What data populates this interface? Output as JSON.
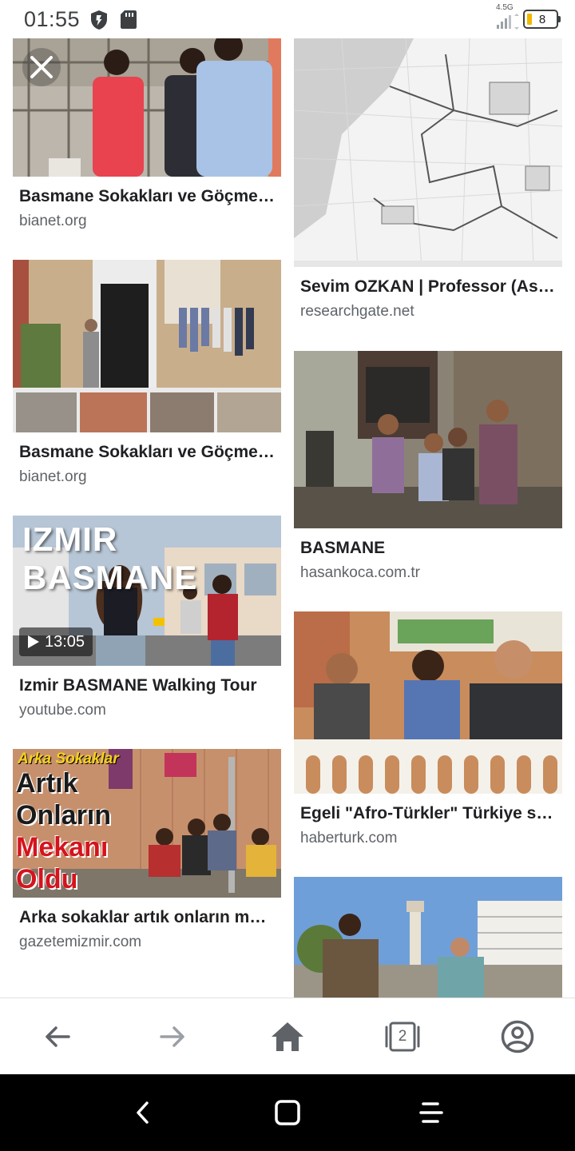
{
  "status_bar": {
    "time": "01:55",
    "network": "4.5G",
    "battery_level": "8",
    "battery_color": "#f2b800"
  },
  "results": [
    {
      "title": "Basmane Sokakları ve Göçmenler",
      "source": "bianet.org"
    },
    {
      "title": "Sevim OZKAN | Professor (Associate)",
      "source": "researchgate.net"
    },
    {
      "title": "Basmane Sokakları ve Göçmenler",
      "source": "bianet.org"
    },
    {
      "title": "BASMANE",
      "source": "hasankoca.com.tr"
    },
    {
      "title": "Izmir BASMANE Walking Tour",
      "source": "youtube.com",
      "thumb_text": "IZMIR BASMANE",
      "duration": "13:05"
    },
    {
      "title": "Egeli \"Afro-Türkler\" Türkiye seçim",
      "source": "haberturk.com"
    },
    {
      "title": "Arka sokaklar artık onların mekanı oldu",
      "source": "gazetemizmir.com",
      "thumb_lines": [
        "Arka Sokaklar",
        "Artık",
        "Onların",
        "Mekanı",
        "Oldu"
      ]
    },
    {
      "title": "",
      "source": ""
    }
  ],
  "toolbar": {
    "back_icon": "arrow-left-icon",
    "forward_icon": "arrow-right-icon",
    "home_icon": "home-icon",
    "tabs_count": "2",
    "account_icon": "account-circle-icon",
    "disabled_color": "#9aa0a6",
    "active_color": "#5f6368"
  },
  "navbar": {
    "back_icon": "chevron-left-icon",
    "home_icon": "square-icon",
    "recents_icon": "menu-lines-icon"
  }
}
